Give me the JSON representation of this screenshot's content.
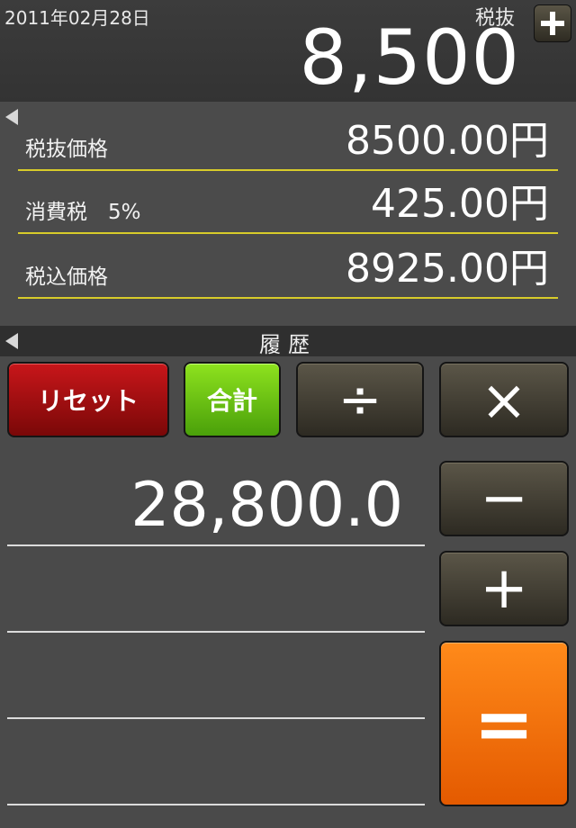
{
  "header": {
    "date": "2011年02月28日",
    "mode": "税抜",
    "display": "8,500",
    "add_icon": "plus-icon"
  },
  "tax_panel": {
    "rows": [
      {
        "label": "税抜価格",
        "value": "8500.00円"
      },
      {
        "label": "消費税　5%",
        "value": "425.00円"
      },
      {
        "label": "税込価格",
        "value": "8925.00円"
      }
    ]
  },
  "history": {
    "title": "履歴",
    "tape": [
      "28,800.0",
      "",
      "",
      ""
    ]
  },
  "keys": {
    "reset": "リセット",
    "sum": "合計",
    "divide": "÷",
    "multiply": "×",
    "minus": "−",
    "plus": "+",
    "equal": "="
  },
  "colors": {
    "reset": "#b01214",
    "sum": "#6cc414",
    "equal": "#f27100",
    "row_divider": "#d8cc2a"
  }
}
